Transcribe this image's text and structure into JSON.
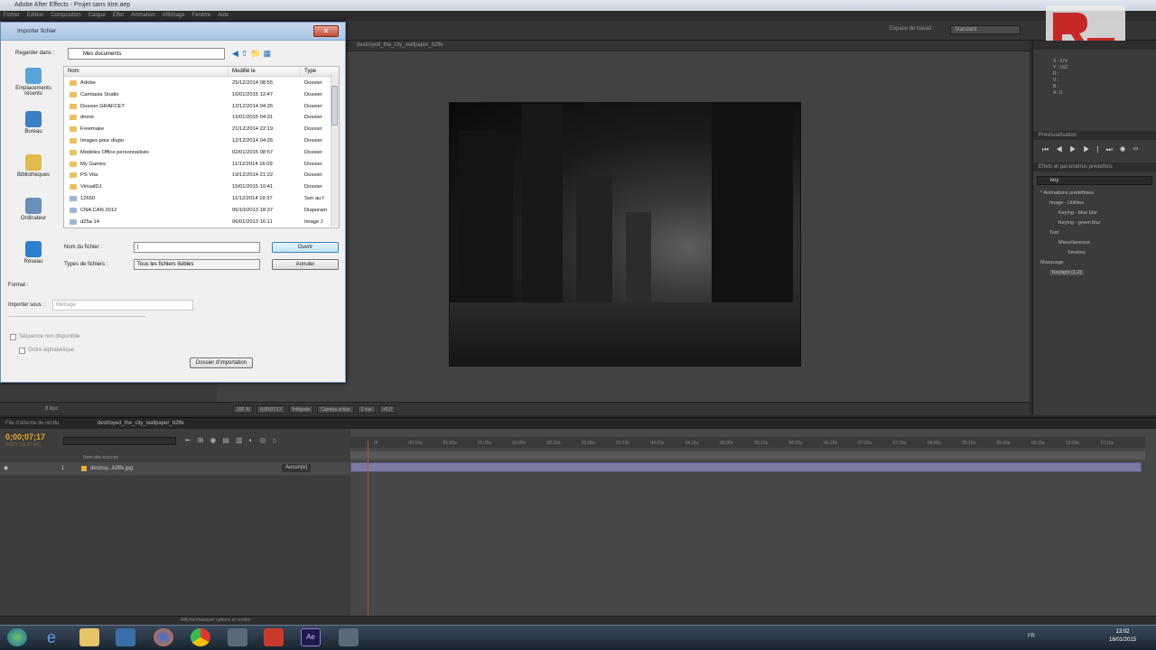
{
  "app": {
    "title": "Adobe After Effects - Projet sans titre.aep",
    "menu": [
      "Fichier",
      "Edition",
      "Composition",
      "Calque",
      "Effet",
      "Animation",
      "Affichage",
      "Fenêtre",
      "Aide"
    ],
    "workspace_label": "Espace de travail :",
    "workspace_value": "Standard"
  },
  "viewer": {
    "tab": "destroyed_the_city_wallpaper_b2lfe",
    "toolbar": [
      "100 %",
      "0;00;07;17",
      "Intégrale",
      "Caméra active",
      "1 vue",
      "+0,0"
    ],
    "image_name": "destroyed city wallpaper"
  },
  "project_panel": {
    "bpc": "8 bpc"
  },
  "right_panel": {
    "info_lines": [
      "X : 374",
      "Y : 163",
      "R :",
      "V :",
      "B :",
      "A : 0"
    ],
    "preview_header": "Prévisualisation",
    "effects_header": "Effets et paramètres prédéfinis",
    "search_value": "key",
    "tree": [
      {
        "label": "* Animations prédéfinies",
        "indent": 0
      },
      {
        "label": "Image - Utilities",
        "indent": 1
      },
      {
        "label": "Keying - blue blur",
        "indent": 2
      },
      {
        "label": "Keying - green blur",
        "indent": 2
      },
      {
        "label": "Text",
        "indent": 1
      },
      {
        "label": "Miscellaneous",
        "indent": 2
      },
      {
        "label": "Smokey",
        "indent": 3
      },
      {
        "label": "Masquage",
        "indent": 0
      },
      {
        "label": "Keylight (1.2)",
        "indent": 1
      }
    ]
  },
  "timeline": {
    "tabs": [
      "File d'attente de rendu",
      "destroyed_the_city_wallpaper_b2lfe"
    ],
    "timecode": "0;00;07;17",
    "timecode_sub": "00227 (29,97 ips)",
    "columns": "Nom des sources",
    "layer_number": "1",
    "layer_name": "destroy...b2lfe.jpg",
    "layer_mode": "Aucun(e)",
    "ruler": [
      "0f",
      "00:15s",
      "01:00s",
      "01:15s",
      "02:00s",
      "02:15s",
      "03:00s",
      "03:15s",
      "04:00s",
      "04:15s",
      "05:00s",
      "05:15s",
      "06:00s",
      "06:15s",
      "07:00s",
      "07:15s",
      "08:00s",
      "08:15s",
      "09:00s",
      "09:15s",
      "10:00s",
      "10:15s"
    ],
    "bottom": "Afficher/masquer options et modes"
  },
  "dialog": {
    "title": "Importer fichier",
    "lookin_label": "Regarder dans :",
    "lookin_value": "Mes documents",
    "places": [
      "Emplacements récents",
      "Bureau",
      "Bibliothèques",
      "Ordinateur",
      "Réseau"
    ],
    "columns": [
      "Nom",
      "Modifié le",
      "Type"
    ],
    "files": [
      {
        "name": "Adobe",
        "date": "25/12/2014 08:55",
        "type": "Dossier"
      },
      {
        "name": "Camtasia Studio",
        "date": "16/01/2015 12:47",
        "type": "Dossier"
      },
      {
        "name": "Dossier GRAFCET",
        "date": "12/12/2014 04:26",
        "type": "Dossier"
      },
      {
        "name": "drone",
        "date": "15/01/2015 04:31",
        "type": "Dossier"
      },
      {
        "name": "Freemake",
        "date": "21/12/2014 22:19",
        "type": "Dossier"
      },
      {
        "name": "Images pour diapo",
        "date": "12/12/2014 04:26",
        "type": "Dossier"
      },
      {
        "name": "Modèles Office personnalisés",
        "date": "02/01/2015 08:57",
        "type": "Dossier"
      },
      {
        "name": "My Games",
        "date": "11/12/2014 16:09",
        "type": "Dossier"
      },
      {
        "name": "PS Vita",
        "date": "19/12/2014 21:22",
        "type": "Dossier"
      },
      {
        "name": "VirtualDJ",
        "date": "15/01/2015 10:41",
        "type": "Dossier"
      },
      {
        "name": "12650",
        "date": "11/12/2014 19:37",
        "type": "Son au f"
      },
      {
        "name": "CNA CAN 2012",
        "date": "06/10/2013 18:37",
        "type": "Diaporam"
      },
      {
        "name": "d25a 14",
        "date": "06/01/2013 16:11",
        "type": "Image J"
      }
    ],
    "filename_label": "Nom du fichier :",
    "filename_value": "|",
    "filetype_label": "Types de fichiers :",
    "filetype_value": "Tous les fichiers lisibles",
    "open_button": "Ouvrir",
    "cancel_button": "Annuler",
    "format_label": "Format :",
    "import_as_label": "Importer sous :",
    "import_as_value": "Métrage",
    "sequence_label": "Séquence non disponible",
    "alpha_label": "Ordre alphabétique",
    "import_folder_button": "Dossier d'importation"
  },
  "taskbar": {
    "lang": "FR",
    "time": "13:02",
    "date": "16/01/2015"
  }
}
